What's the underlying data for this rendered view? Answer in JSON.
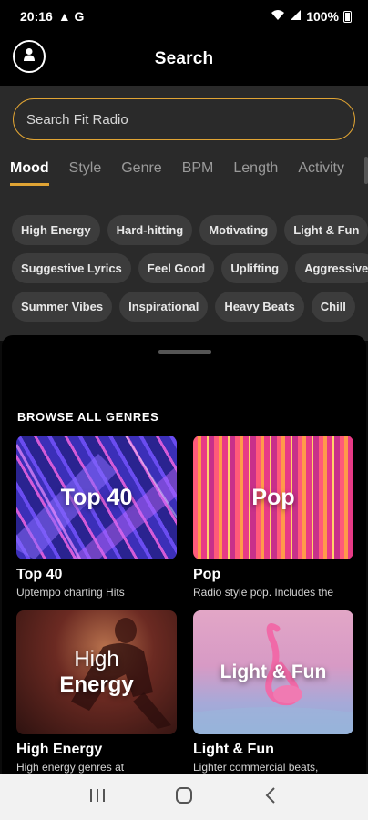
{
  "status_bar": {
    "time": "20:16",
    "indicators": "▲ G",
    "battery": "100%"
  },
  "header": {
    "title": "Search",
    "profile_icon": "person-icon"
  },
  "search": {
    "placeholder": "Search Fit Radio"
  },
  "tabs": [
    {
      "label": "Mood",
      "active": true
    },
    {
      "label": "Style",
      "active": false
    },
    {
      "label": "Genre",
      "active": false
    },
    {
      "label": "BPM",
      "active": false
    },
    {
      "label": "Length",
      "active": false
    },
    {
      "label": "Activity",
      "active": false
    }
  ],
  "mood_chips": [
    [
      "High Energy",
      "Hard-hitting",
      "Motivating",
      "Light & Fun"
    ],
    [
      "Suggestive Lyrics",
      "Feel Good",
      "Uplifting",
      "Aggressive"
    ],
    [
      "Summer Vibes",
      "Inspirational",
      "Heavy Beats",
      "Chill"
    ]
  ],
  "browse": {
    "title": "BROWSE ALL GENRES",
    "genres": [
      {
        "thumb_text": "Top 40",
        "name": "Top 40",
        "description": "Uptempo charting Hits"
      },
      {
        "thumb_text": "Pop",
        "name": "Pop",
        "description": "Radio style pop. Includes the"
      },
      {
        "thumb_text_line1": "High",
        "thumb_text_line2": "Energy",
        "name": "High Energy",
        "description": "High energy genres at"
      },
      {
        "thumb_text": "Light & Fun",
        "name": "Light & Fun",
        "description": "Lighter commercial beats,"
      }
    ]
  },
  "colors": {
    "accent": "#e0a434",
    "background": "#0b0b0b",
    "panel": "#2a2a2a",
    "chip": "#3c3c3c"
  },
  "nav": {
    "icons": [
      "recents-icon",
      "home-icon",
      "back-icon"
    ]
  }
}
